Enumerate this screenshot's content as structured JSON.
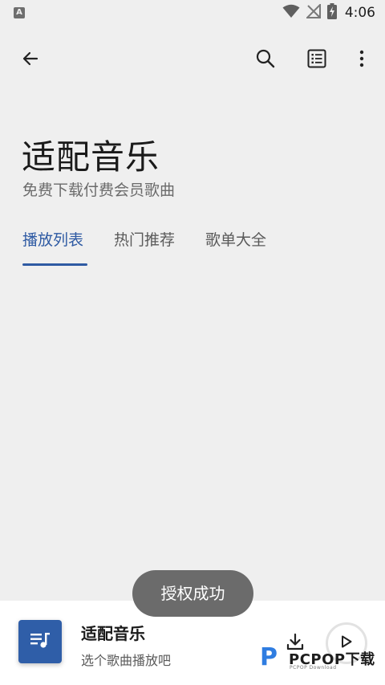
{
  "status_bar": {
    "left_icon_letter": "A",
    "time": "4:06",
    "icons": [
      "wifi-icon",
      "signal-off-icon",
      "battery-charging-icon"
    ]
  },
  "top_bar": {
    "icons": [
      "back-arrow-icon",
      "search-icon",
      "list-icon",
      "more-vert-icon"
    ]
  },
  "header": {
    "title": "适配音乐",
    "subtitle": "免费下载付费会员歌曲"
  },
  "tabs": [
    {
      "label": "播放列表",
      "active": true
    },
    {
      "label": "热门推荐",
      "active": false
    },
    {
      "label": "歌单大全",
      "active": false
    }
  ],
  "toast": {
    "message": "授权成功"
  },
  "player": {
    "title": "适配音乐",
    "subtitle": "选个歌曲播放吧",
    "icons": [
      "playlist-music-icon",
      "download-icon",
      "play-icon"
    ]
  },
  "watermark": {
    "logo_letter": "P",
    "text": "PCPOP下载",
    "subtext": "PCPOP Download"
  },
  "colors": {
    "background": "#efefef",
    "accent": "#2e5aa3",
    "album_art": "#2f5ea8",
    "toast_bg": "#6b6b6b",
    "player_bg": "#ffffff"
  }
}
